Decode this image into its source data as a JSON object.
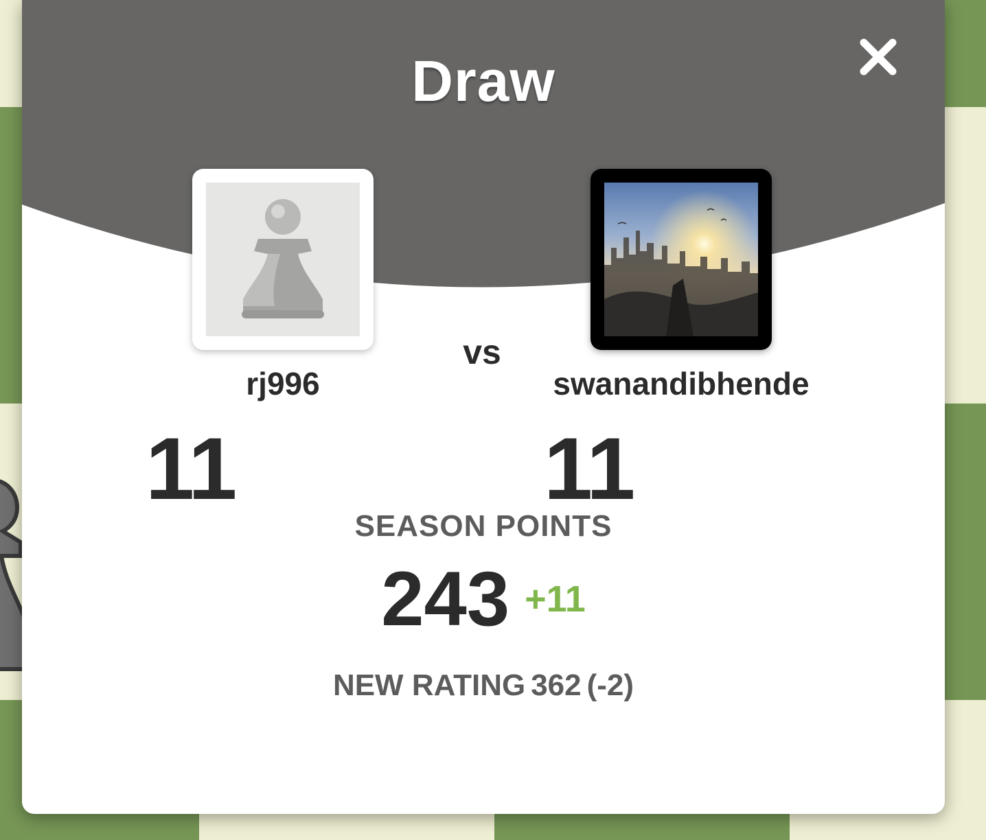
{
  "modal": {
    "title": "Draw",
    "close_icon": "close-icon",
    "vs_label": "vs",
    "season_points_label": "SEASON POINTS",
    "season_points_value": "243",
    "season_points_delta": "+11",
    "new_rating_label": "NEW RATING",
    "new_rating_value": "362",
    "new_rating_change": "(-2)"
  },
  "players": {
    "left": {
      "username": "rj996",
      "score": "11",
      "avatar": "pawn-icon"
    },
    "right": {
      "username": "swanandibhende",
      "score": "11",
      "avatar": "city-sunset-photo"
    }
  },
  "colors": {
    "header": "#676665",
    "board_dark": "#769656",
    "board_light": "#eeeed2",
    "accent_green": "#81b64c"
  }
}
